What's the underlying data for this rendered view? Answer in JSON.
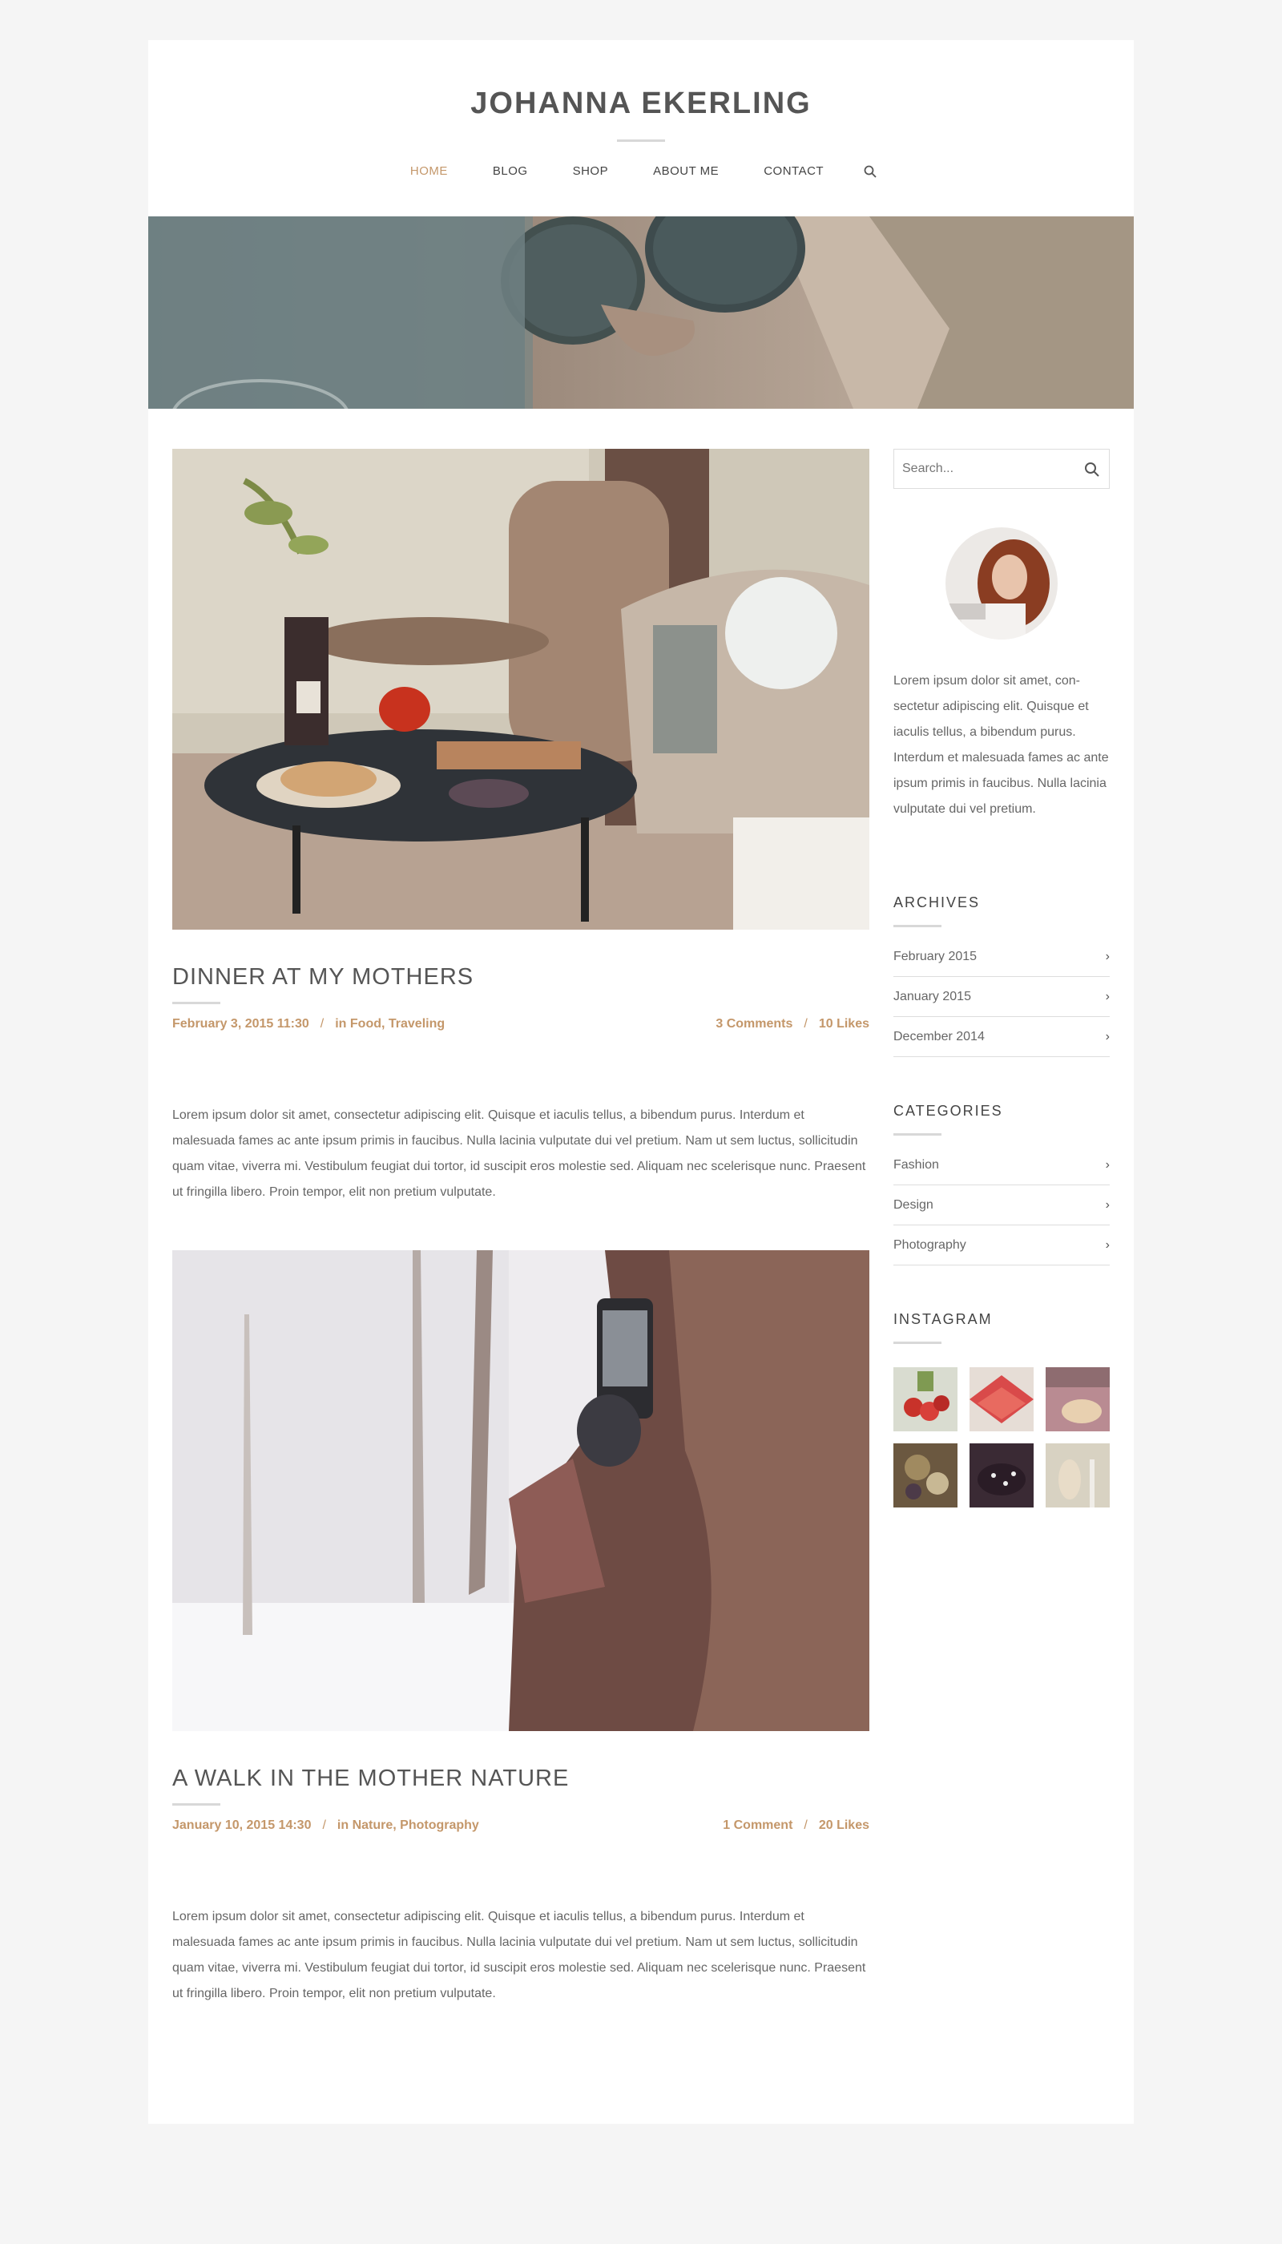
{
  "site": {
    "title": "JOHANNA EKERLING"
  },
  "nav": {
    "items": [
      {
        "label": "HOME",
        "active": true
      },
      {
        "label": "BLOG",
        "active": false
      },
      {
        "label": "SHOP",
        "active": false
      },
      {
        "label": "ABOUT ME",
        "active": false
      },
      {
        "label": "CONTACT",
        "active": false
      }
    ],
    "search_icon": "search-icon"
  },
  "colors": {
    "accent": "#c4976a",
    "text": "#555555",
    "background": "#f5f5f5"
  },
  "posts": [
    {
      "title": "DINNER AT MY MOTHERS",
      "date": "February 3, 2015 11:30",
      "sep1": "/",
      "categories": "in Food, Traveling",
      "comments": "3 Comments",
      "sep2": "/",
      "likes": "10 Likes",
      "excerpt": "Lorem ipsum dolor sit amet, consectetur adipiscing elit. Quisque et iaculis tellus, a bibendum purus. Interdum et malesuada fames ac ante ipsum primis in faucibus. Nulla lacinia vulputate dui vel pretium. Nam ut sem luctus, sollicitudin quam vitae, viverra mi. Vestibulum feugiat dui tortor, id suscipit eros molestie sed. Aliquam nec scelerisque nunc. Praesent ut fringilla libero. Proin tempor, elit non pretium vulputate."
    },
    {
      "title": "A WALK IN THE MOTHER NATURE",
      "date": "January 10, 2015 14:30",
      "sep1": "/",
      "categories": "in Nature, Photography",
      "comments": "1 Comment",
      "sep2": "/",
      "likes": "20 Likes",
      "excerpt": "Lorem ipsum dolor sit amet, consectetur adipiscing elit. Quisque et iaculis tellus, a bibendum purus. Interdum et malesuada fames ac ante ipsum primis in faucibus. Nulla lacinia vulputate dui vel pretium. Nam ut sem luctus, sollicitudin quam vitae, viverra mi. Vestibulum feugiat dui tortor, id suscipit eros molestie sed. Aliquam nec scelerisque nunc. Praesent ut fringilla libero. Proin tempor, elit non pretium vulputate."
    }
  ],
  "sidebar": {
    "search_placeholder": "Search...",
    "bio": "Lorem ipsum dolor sit amet, con-sectetur adipiscing elit. Quisque et iaculis tellus, a bibendum purus. Interdum et malesuada fames ac ante ipsum primis in faucibus. Nulla lacinia vulputate dui vel pretium.",
    "archives": {
      "title": "ARCHIVES",
      "items": [
        {
          "label": "February 2015",
          "chevron": "›"
        },
        {
          "label": "January 2015",
          "chevron": "›"
        },
        {
          "label": "December 2014",
          "chevron": "›"
        }
      ]
    },
    "categories": {
      "title": "CATEGORIES",
      "items": [
        {
          "label": "Fashion",
          "chevron": "›"
        },
        {
          "label": "Design",
          "chevron": "›"
        },
        {
          "label": "Photography",
          "chevron": "›"
        }
      ]
    },
    "instagram": {
      "title": "INSTAGRAM"
    }
  }
}
